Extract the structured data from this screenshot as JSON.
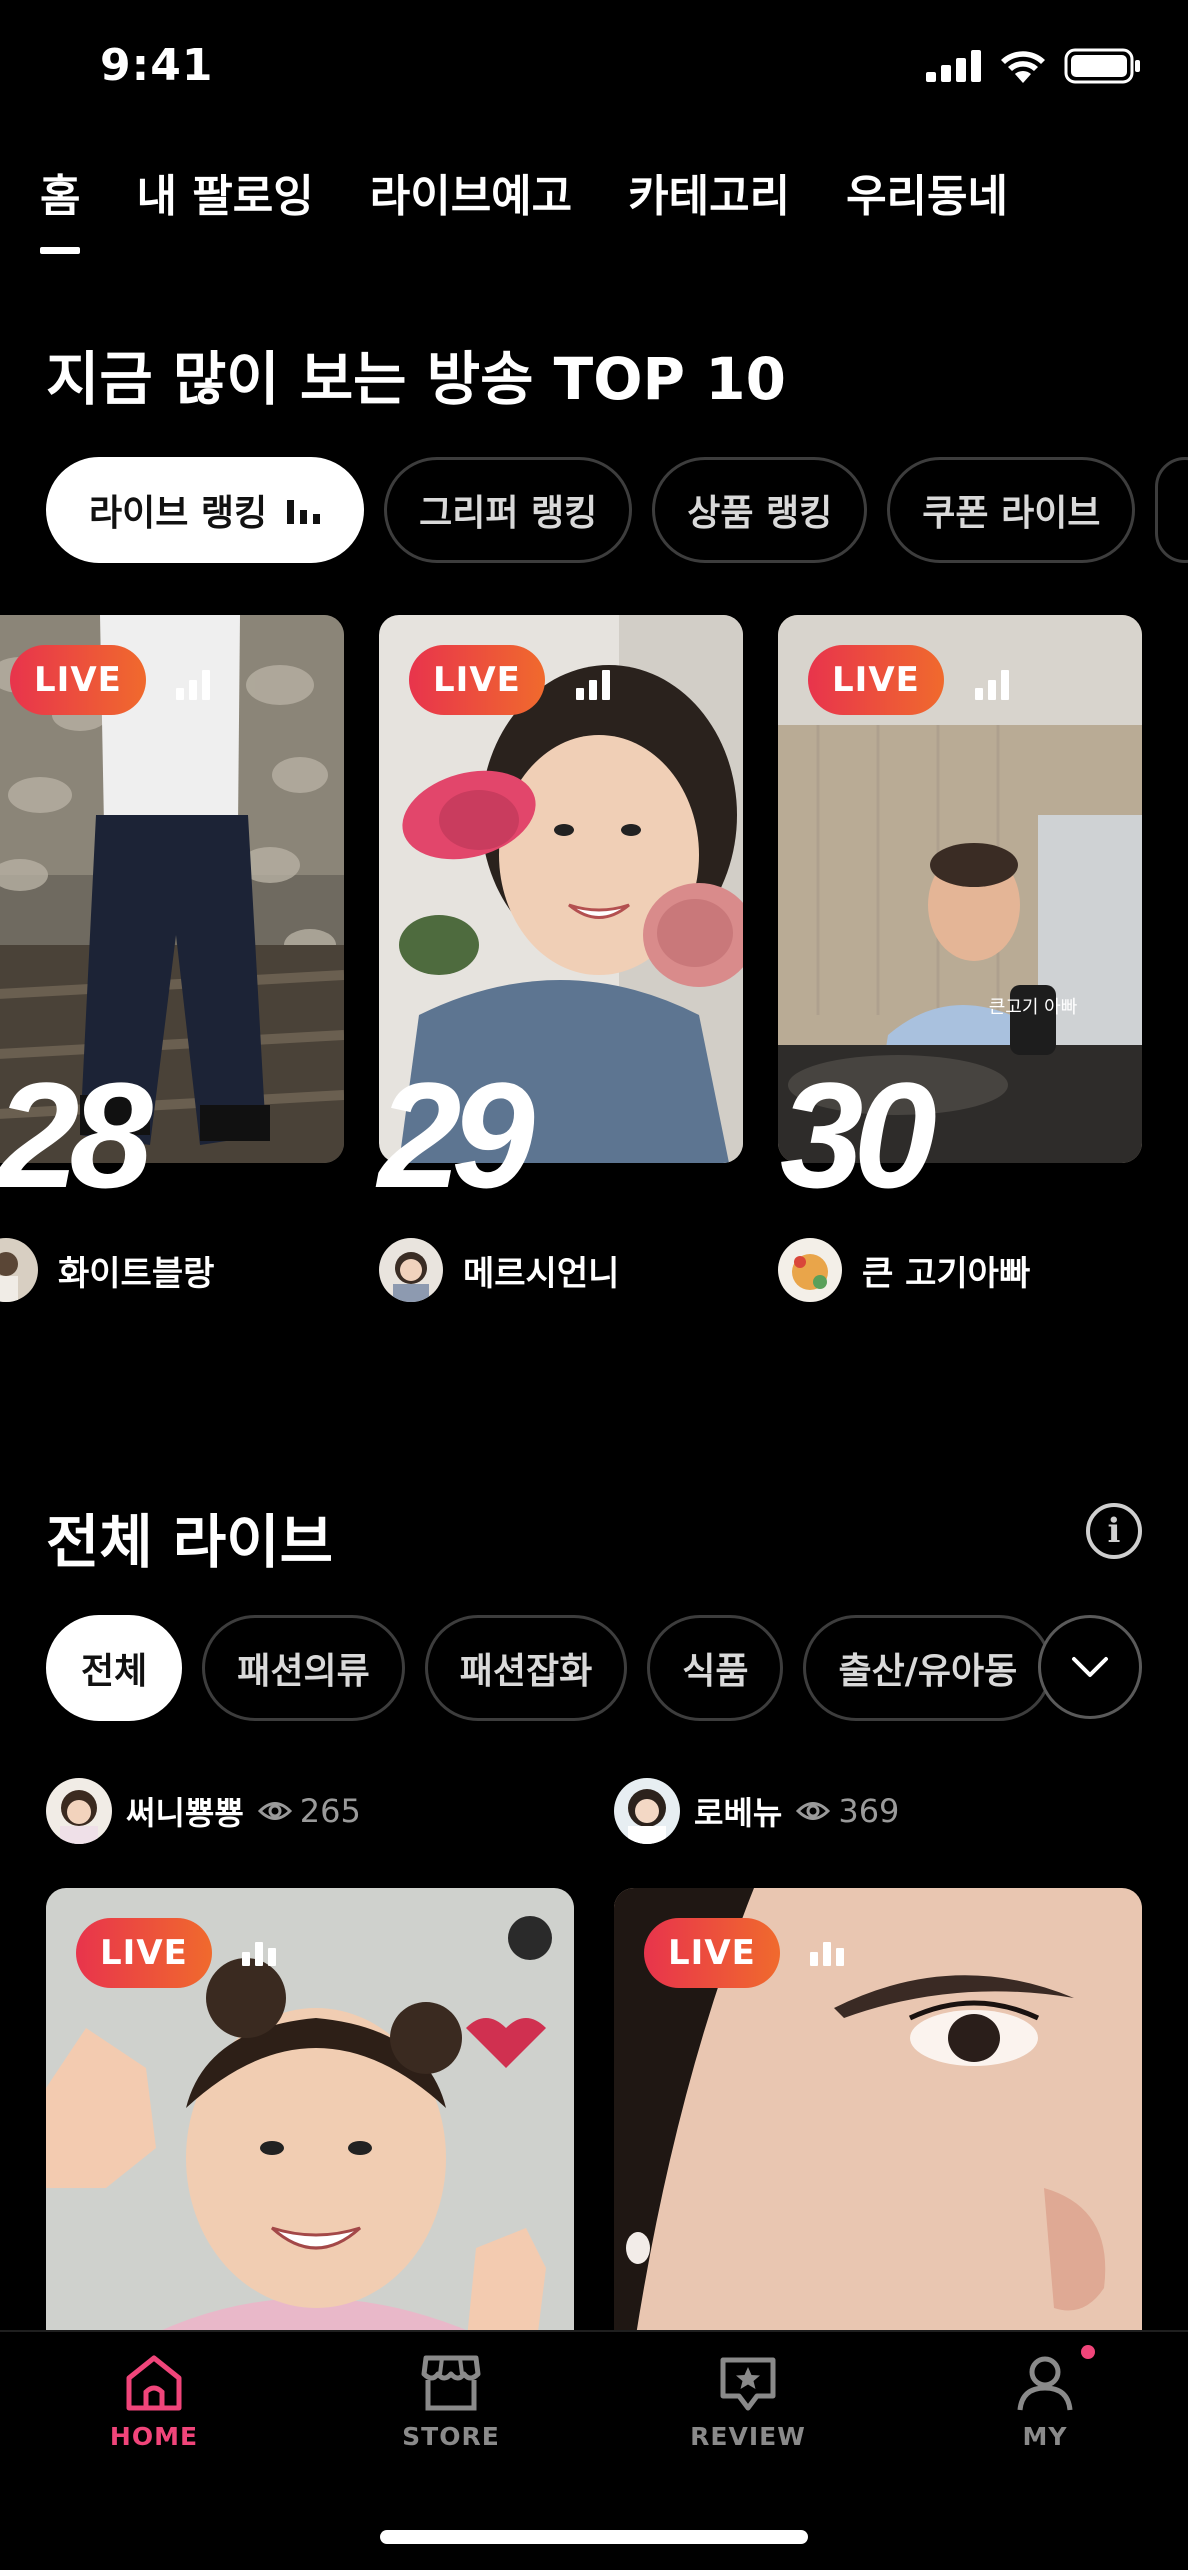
{
  "status": {
    "time": "9:41"
  },
  "top_tabs": [
    "홈",
    "내 팔로잉",
    "라이브예고",
    "카테고리",
    "우리동네"
  ],
  "top10": {
    "title": "지금 많이 보는 방송 TOP 10",
    "filters": [
      "라이브 랭킹",
      "그리퍼 랭킹",
      "상품 랭킹",
      "쿠폰 라이브"
    ],
    "items": [
      {
        "rank": "28",
        "seller": "화이트블랑"
      },
      {
        "rank": "29",
        "seller": "메르시언니"
      },
      {
        "rank": "30",
        "seller": "큰 고기아빠"
      }
    ]
  },
  "all_live": {
    "title": "전체 라이브",
    "categories": [
      "전체",
      "패션의류",
      "패션잡화",
      "식품",
      "출산/유아동"
    ],
    "streams": [
      {
        "seller": "써니뿅뿅",
        "viewers": "265"
      },
      {
        "seller": "로베뉴",
        "viewers": "369"
      }
    ]
  },
  "live_label": "LIVE",
  "sign_text": "큰고기 아빠",
  "bottom_nav": [
    {
      "label": "HOME",
      "icon": "home-icon",
      "active": true
    },
    {
      "label": "STORE",
      "icon": "store-icon",
      "active": false
    },
    {
      "label": "REVIEW",
      "icon": "review-icon",
      "active": false
    },
    {
      "label": "MY",
      "icon": "profile-icon",
      "active": false
    }
  ],
  "colors": {
    "accent": "#f0457a",
    "live_start": "#e8344c",
    "live_end": "#f06a2d",
    "background": "#000000"
  }
}
